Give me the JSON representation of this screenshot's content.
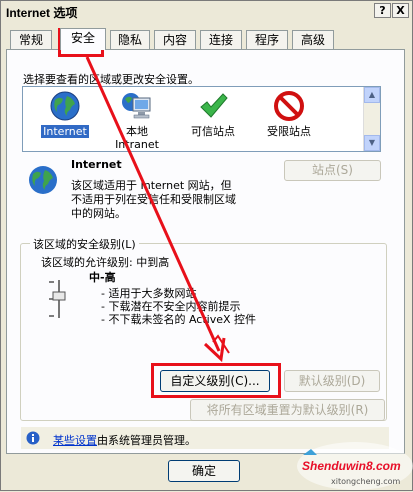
{
  "window": {
    "title": "Internet 选项",
    "help_btn": "?",
    "close_btn": "X"
  },
  "tabs": [
    {
      "label": "常规"
    },
    {
      "label": "安全"
    },
    {
      "label": "隐私"
    },
    {
      "label": "内容"
    },
    {
      "label": "连接"
    },
    {
      "label": "程序"
    },
    {
      "label": "高级"
    }
  ],
  "security": {
    "select_zone_prompt": "选择要查看的区域或更改安全设置。",
    "zones": [
      {
        "label": "Internet",
        "icon": "globe-icon"
      },
      {
        "label": "本地",
        "label2": "Intranet",
        "icon": "computer-icon"
      },
      {
        "label": "可信站点",
        "icon": "checkmark-icon"
      },
      {
        "label": "受限站点",
        "icon": "restricted-icon"
      }
    ],
    "zone_title": "Internet",
    "zone_desc_1": "该区域适用于 Internet 网站，但",
    "zone_desc_2": "不适用于列在受信任和受限制区域",
    "zone_desc_3": "中的网站。",
    "sites_button": "站点(S)",
    "level_group_label": "该区域的安全级别(L)",
    "allowed_levels": "该区域的允许级别: 中到高",
    "level_name": "中-高",
    "level_bullets": [
      "- 适用于大多数网站",
      "- 下载潜在不安全内容前提示",
      "- 不下载未签名的 ActiveX 控件"
    ],
    "custom_level_button": "自定义级别(C)...",
    "default_level_button": "默认级别(D)",
    "reset_all_button": "将所有区域重置为默认级别(R)",
    "info_link": "某些设置",
    "info_text": "由系统管理员管理。"
  },
  "footer": {
    "ok_button": "确定"
  },
  "watermark": {
    "main": "Shenduwin8.com",
    "sub": "xitongcheng.com"
  },
  "colors": {
    "annotation_red": "#e8101a",
    "selection_blue": "#316ac5",
    "dialog_bg": "#ece9d8"
  }
}
